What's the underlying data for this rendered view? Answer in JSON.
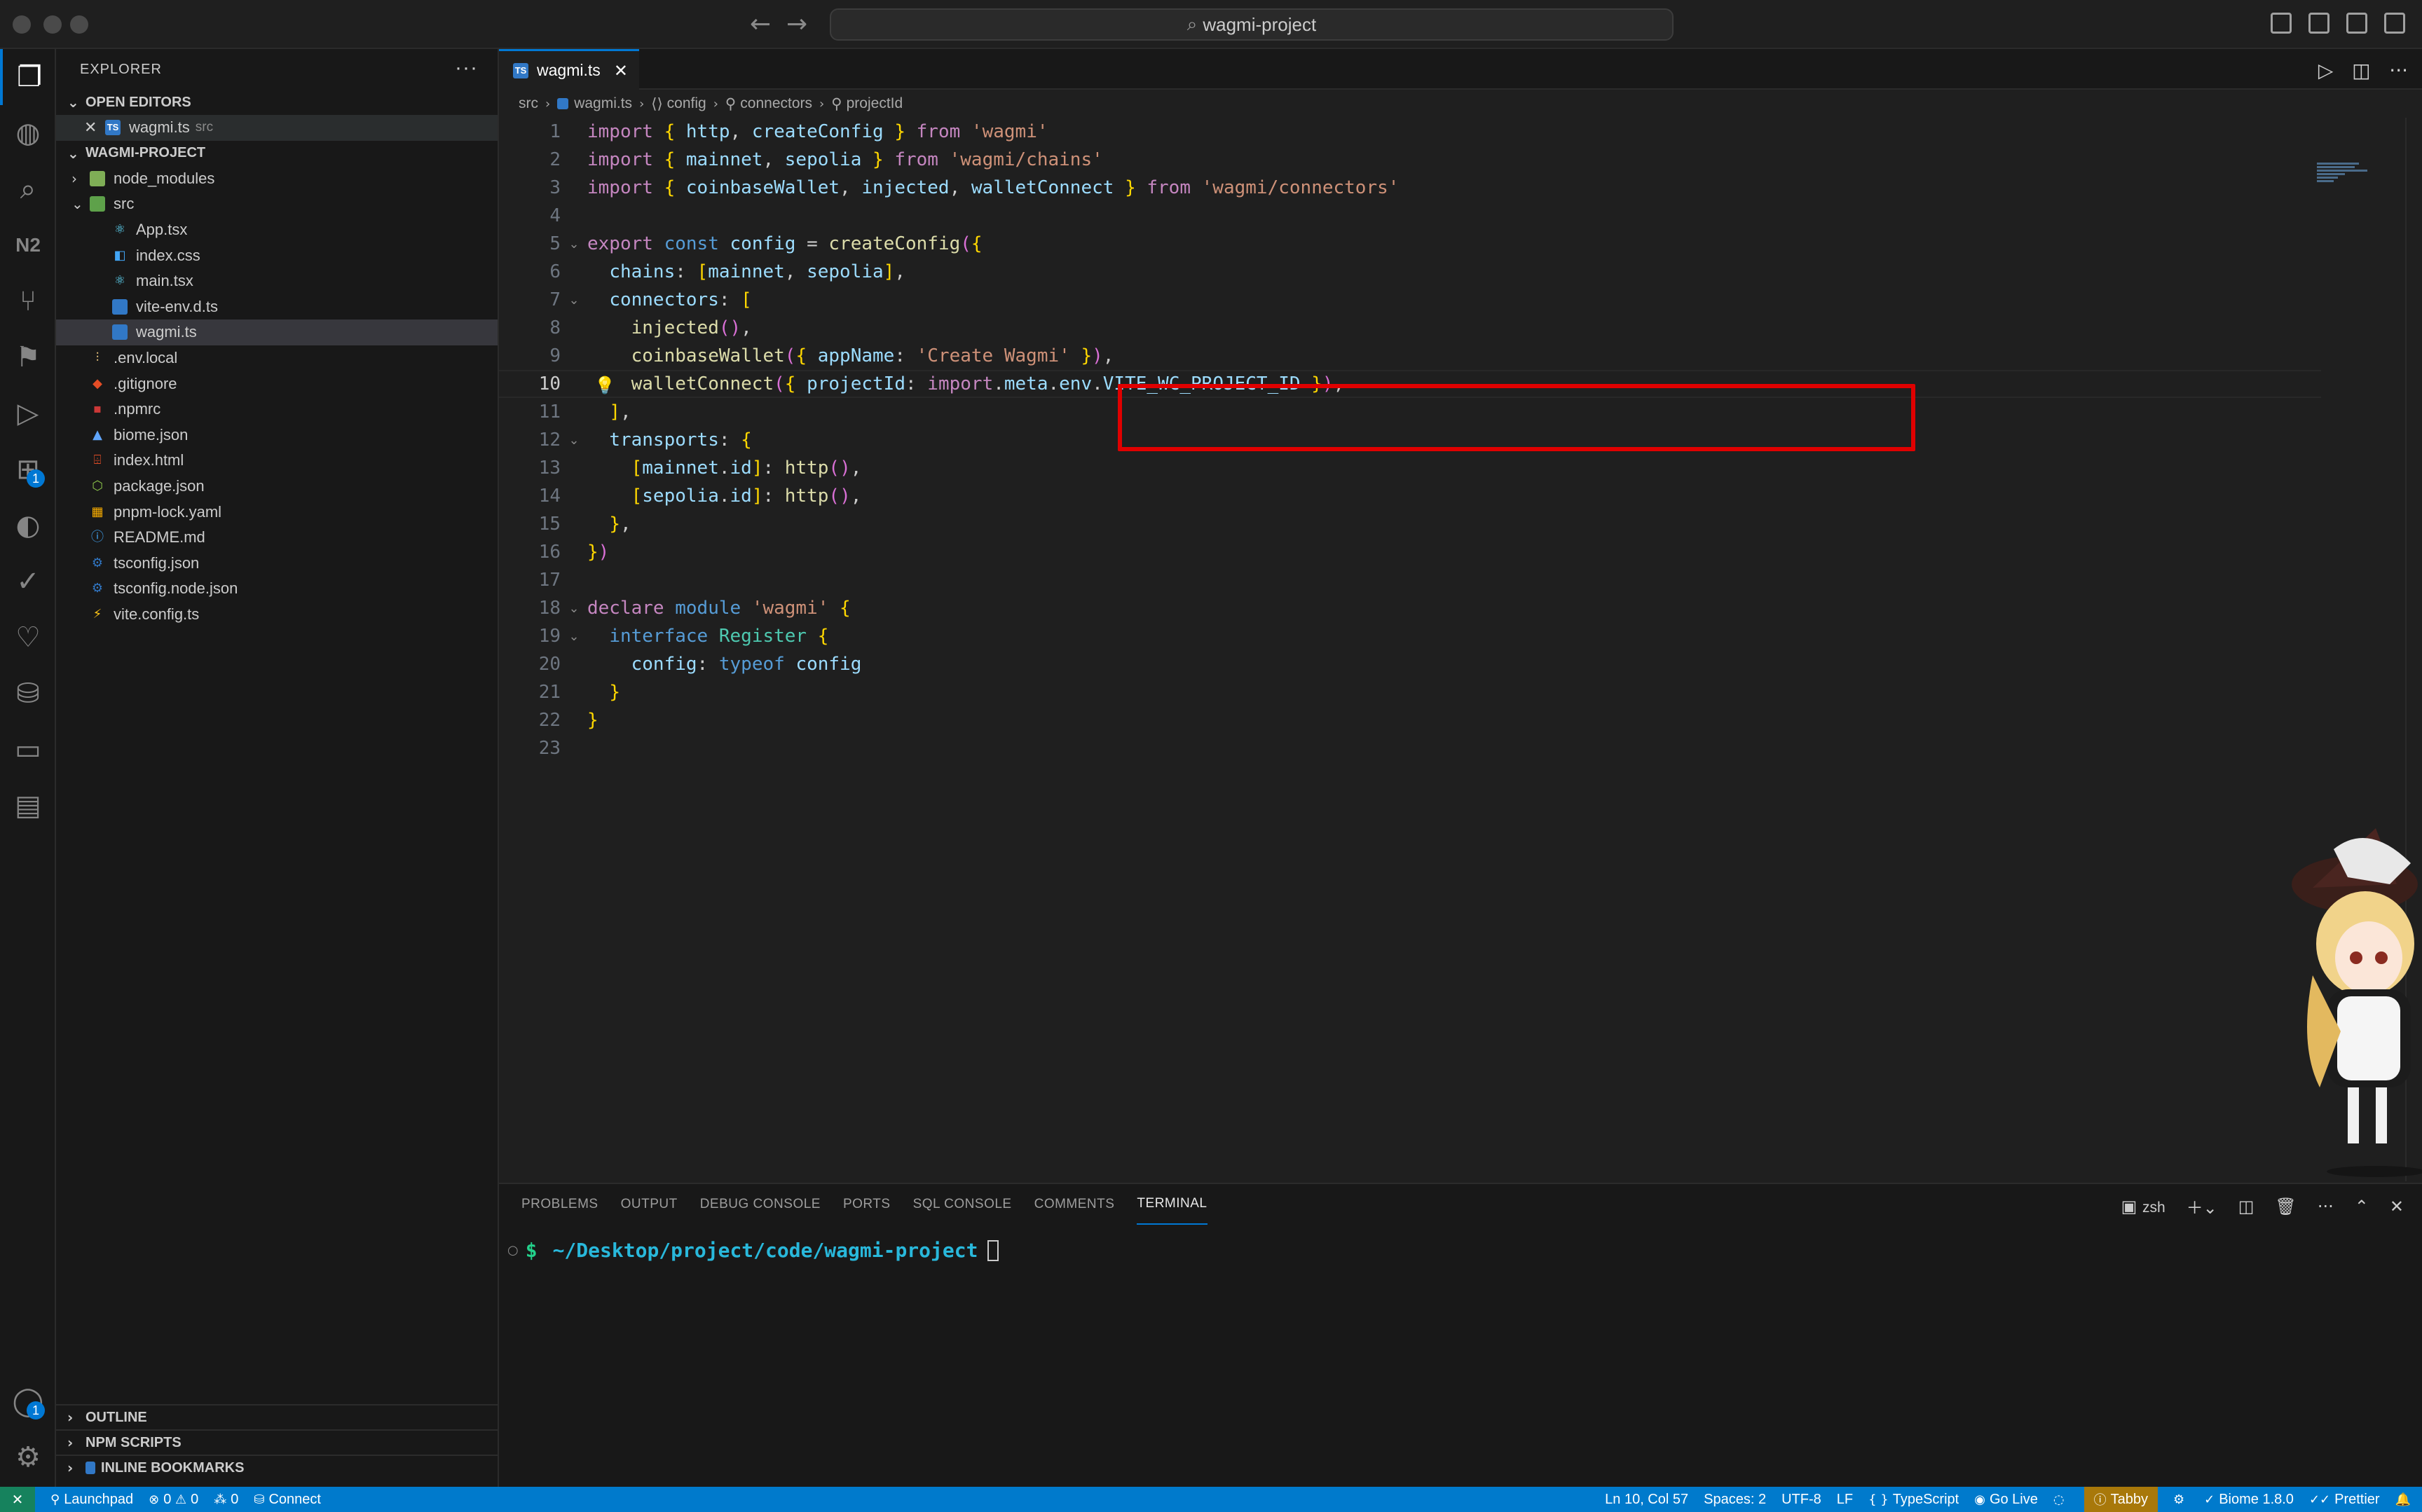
{
  "titlebar": {
    "search_text": "wagmi-project"
  },
  "activity_bar": {
    "items": [
      "explorer-icon",
      "copilot-icon",
      "search-icon",
      "n2-icon",
      "source-control-icon",
      "bookmark-icon",
      "run-debug-icon",
      "extensions-icon",
      "git-graph-icon",
      "testing-icon",
      "heart-icon",
      "database-icon",
      "remote-explorer-icon",
      "folder-icon"
    ],
    "n2_label": "N2",
    "extensions_badge": "1",
    "accounts_badge": "1"
  },
  "sidebar": {
    "title": "EXPLORER",
    "open_editors_label": "OPEN EDITORS",
    "open_editor": {
      "name": "wagmi.ts",
      "hint": "src"
    },
    "project_label": "WAGMI-PROJECT",
    "tree": [
      {
        "name": "node_modules",
        "type": "folder",
        "depth": 1
      },
      {
        "name": "src",
        "type": "folder-open",
        "depth": 1
      },
      {
        "name": "App.tsx",
        "type": "react",
        "depth": 2
      },
      {
        "name": "index.css",
        "type": "css",
        "depth": 2
      },
      {
        "name": "main.tsx",
        "type": "react",
        "depth": 2
      },
      {
        "name": "vite-env.d.ts",
        "type": "ts",
        "depth": 2
      },
      {
        "name": "wagmi.ts",
        "type": "ts",
        "depth": 2
      },
      {
        "name": ".env.local",
        "type": "env",
        "depth": 1
      },
      {
        "name": ".gitignore",
        "type": "git",
        "depth": 1
      },
      {
        "name": ".npmrc",
        "type": "npm",
        "depth": 1
      },
      {
        "name": "biome.json",
        "type": "biome",
        "depth": 1
      },
      {
        "name": "index.html",
        "type": "html",
        "depth": 1
      },
      {
        "name": "package.json",
        "type": "node",
        "depth": 1
      },
      {
        "name": "pnpm-lock.yaml",
        "type": "pnpm",
        "depth": 1
      },
      {
        "name": "README.md",
        "type": "info",
        "depth": 1
      },
      {
        "name": "tsconfig.json",
        "type": "tsconfig",
        "depth": 1
      },
      {
        "name": "tsconfig.node.json",
        "type": "tsconfig",
        "depth": 1
      },
      {
        "name": "vite.config.ts",
        "type": "vite",
        "depth": 1
      }
    ],
    "outline_label": "OUTLINE",
    "npm_scripts_label": "NPM SCRIPTS",
    "inline_bookmarks_label": "INLINE BOOKMARKS"
  },
  "editor": {
    "tab_label": "wagmi.ts",
    "breadcrumb": [
      "src",
      "wagmi.ts",
      "config",
      "connectors",
      "projectId"
    ],
    "line_numbers": [
      "1",
      "2",
      "3",
      "4",
      "5",
      "6",
      "7",
      "8",
      "9",
      "10",
      "11",
      "12",
      "13",
      "14",
      "15",
      "16",
      "17",
      "18",
      "19",
      "20",
      "21",
      "22",
      "23"
    ],
    "current_line": "10",
    "code_lines": [
      "import { http, createConfig } from 'wagmi'",
      "import { mainnet, sepolia } from 'wagmi/chains'",
      "import { coinbaseWallet, injected, walletConnect } from 'wagmi/connectors'",
      "",
      "export const config = createConfig({",
      "  chains: [mainnet, sepolia],",
      "  connectors: [",
      "    injected(),",
      "    coinbaseWallet({ appName: 'Create Wagmi' }),",
      "    walletConnect({ projectId: import.meta.env.VITE_WC_PROJECT_ID }),",
      "  ],",
      "  transports: {",
      "    [mainnet.id]: http(),",
      "    [sepolia.id]: http(),",
      "  },",
      "})",
      "",
      "declare module 'wagmi' {",
      "  interface Register {",
      "    config: typeof config",
      "  }",
      "}",
      ""
    ],
    "highlight_color": "#e00000"
  },
  "panel": {
    "tabs": [
      "PROBLEMS",
      "OUTPUT",
      "DEBUG CONSOLE",
      "PORTS",
      "SQL CONSOLE",
      "COMMENTS",
      "TERMINAL"
    ],
    "active_tab": "TERMINAL",
    "shell": "zsh",
    "terminal": {
      "prompt": "$",
      "cwd": "~/Desktop/project/code/wagmi-project"
    }
  },
  "statusbar": {
    "launchpad": "Launchpad",
    "errors": "0",
    "warnings": "0",
    "ports": "0",
    "connect": "Connect",
    "position": "Ln 10, Col 57",
    "spaces": "Spaces: 2",
    "encoding": "UTF-8",
    "eol": "LF",
    "language": "TypeScript",
    "go_live": "Go Live",
    "tabby": "Tabby",
    "biome": "Biome 1.8.0",
    "prettier": "Prettier"
  },
  "colors": {
    "accent": "#0078d4",
    "statusbar": "#007acc",
    "highlight": "#e00000"
  }
}
